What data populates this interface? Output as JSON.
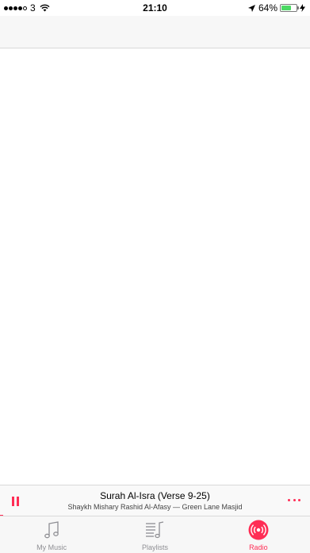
{
  "status_bar": {
    "carrier": "3",
    "time": "21:10",
    "battery": "64%",
    "battery_level": 0.64,
    "signal_bars_filled": 4,
    "signal_bars_total": 5
  },
  "now_playing": {
    "title": "Surah Al-Isra (Verse 9-25)",
    "subtitle": "Shaykh Mishary Rashid Al-Afasy — Green Lane Masjid",
    "progress": 0.01,
    "state_icon": "pause-icon",
    "more_icon": "more-icon"
  },
  "tabs": [
    {
      "label": "My Music",
      "icon": "music-note-icon",
      "active": false
    },
    {
      "label": "Playlists",
      "icon": "playlist-icon",
      "active": false
    },
    {
      "label": "Radio",
      "icon": "radio-icon",
      "active": true
    }
  ],
  "colors": {
    "accent": "#ff2d55",
    "inactive": "#8e8e93",
    "battery_fill": "#4cd964"
  }
}
